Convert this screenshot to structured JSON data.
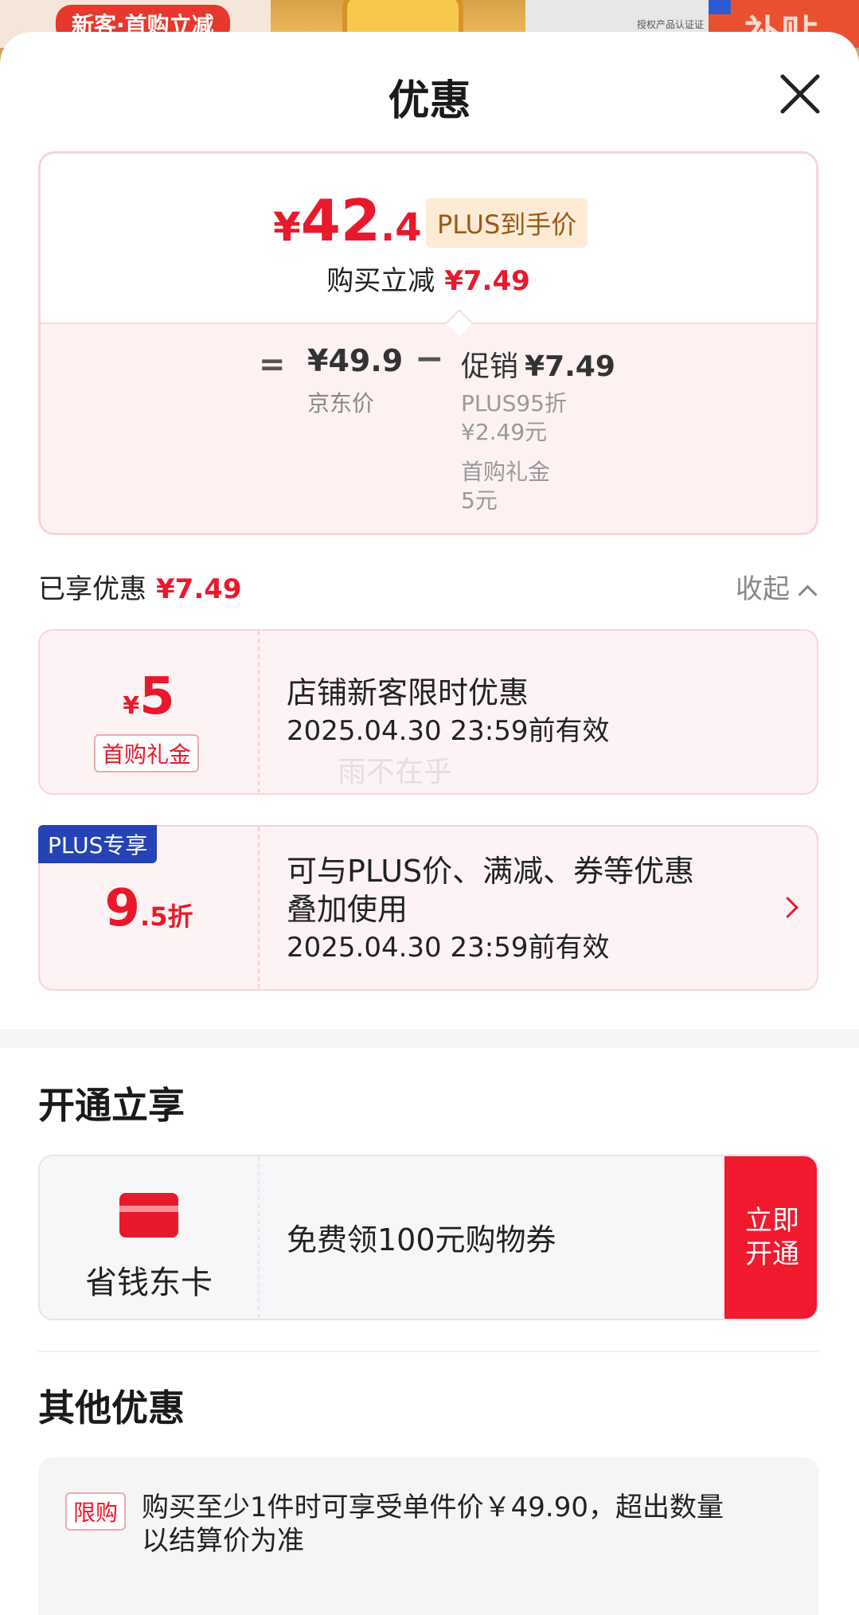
{
  "background": {
    "banner_text": "新客·首购立减",
    "right_text": "补贴",
    "small_text": "授权产品认证证书"
  },
  "sheet": {
    "title": "优惠"
  },
  "price_card": {
    "final_symbol": "¥",
    "final_int": "42",
    "final_dec": ".41",
    "plus_tag": "PLUS到手价",
    "reduce_label": "购买立减",
    "reduce_value": "¥7.49",
    "equals": "=",
    "jd_price": "¥49.9",
    "jd_label": "京东价",
    "minus": "−",
    "promo_label": "促销",
    "promo_value": "¥7.49",
    "promo_sub1": "PLUS95折",
    "promo_sub2": "¥2.49元",
    "promo_sub3": "首购礼金",
    "promo_sub4": "5元"
  },
  "enjoyed": {
    "label": "已享优惠",
    "value": "¥7.49",
    "collapse_label": "收起"
  },
  "coupons": [
    {
      "symbol": "¥",
      "amount": "5",
      "tag": "首购礼金",
      "title": "店铺新客限时优惠",
      "valid": "2025.04.30 23:59前有效"
    },
    {
      "badge": "PLUS专享",
      "amount_int": "9",
      "amount_suffix": ".5折",
      "title_line1": "可与PLUS价、满减、券等优惠",
      "title_line2": "叠加使用",
      "valid": "2025.04.30 23:59前有效"
    }
  ],
  "watermark": "雨不在乎",
  "open_section": {
    "title": "开通立享",
    "card_name": "省钱东卡",
    "desc": "免费领100元购物券",
    "button_line1": "立即",
    "button_line2": "开通"
  },
  "other_section": {
    "title": "其他优惠",
    "limit_tag": "限购",
    "limit_text": "购买至少1件时可享受单件价￥49.90，超出数量以结算价为准"
  },
  "colors": {
    "accent": "#e8192c",
    "plus_badge": "#2543b6",
    "plus_tag_bg": "#fdebd6"
  }
}
